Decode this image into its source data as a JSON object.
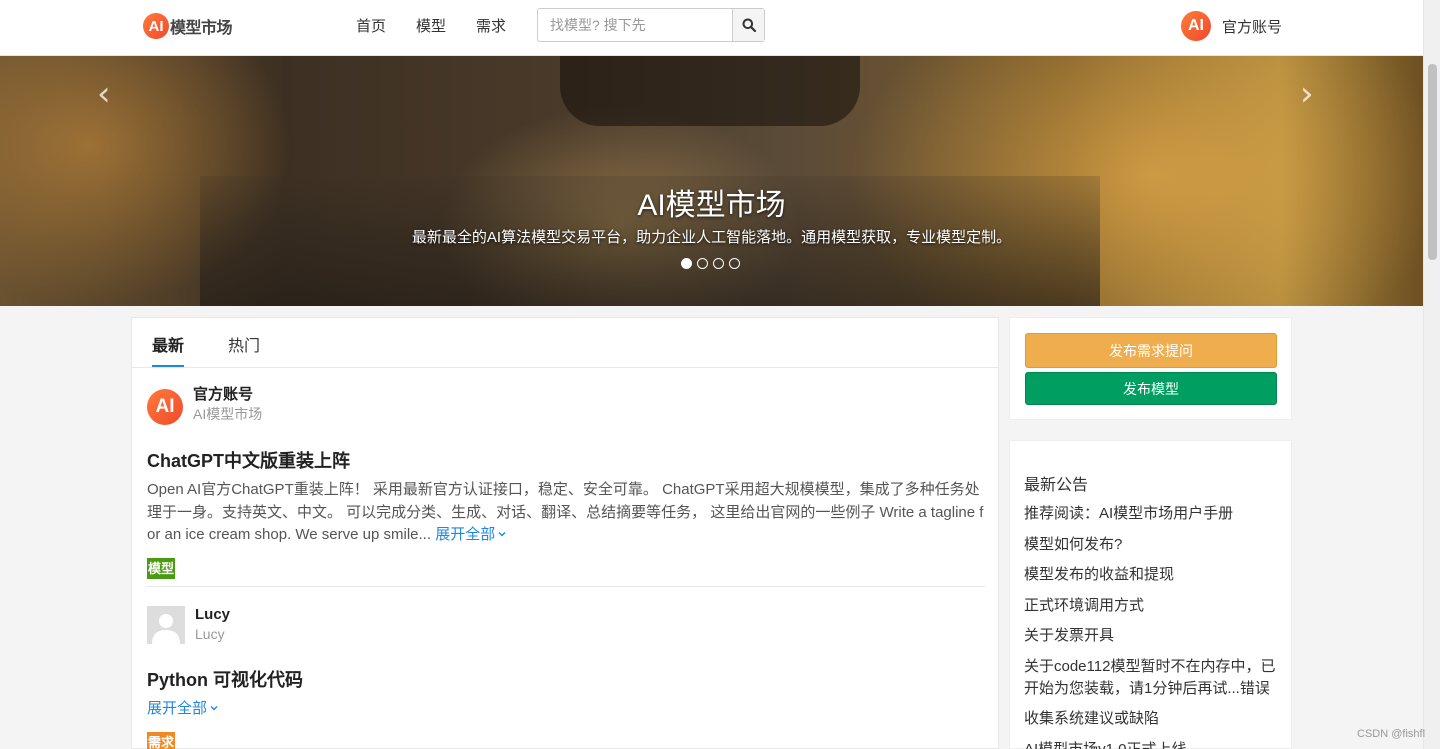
{
  "header": {
    "logo_badge": "AI",
    "logo_text": "模型市场",
    "nav": [
      "首页",
      "模型",
      "需求"
    ],
    "search_placeholder": "找模型? 搜下先",
    "search_icon": "search-icon",
    "account_badge": "AI",
    "account_name": "官方账号"
  },
  "banner": {
    "title": "AI模型市场",
    "subtitle": "最新最全的AI算法模型交易平台，助力企业人工智能落地。通用模型获取，专业模型定制。",
    "prev_icon": "chevron-left-icon",
    "next_icon": "chevron-right-icon",
    "active_slide": 1,
    "slide_count": 4
  },
  "tabs": [
    "最新",
    "热门"
  ],
  "posts": [
    {
      "avatar": "AI",
      "author": "官方账号",
      "author_sub": "AI模型市场",
      "title": "ChatGPT中文版重装上阵",
      "body": "Open AI官方ChatGPT重装上阵！ 采用最新官方认证接口，稳定、安全可靠。 ChatGPT采用超大规模模型，集成了多种任务处理于一身。支持英文、中文。 可以完成分类、生成、对话、翻译、总结摘要等任务， 这里给出官网的一些例子 Write a tagline for an ice cream shop. We serve up smile...",
      "expand": "展开全部",
      "tag": "模型",
      "tag_color": "#4a9a14"
    },
    {
      "author": "Lucy",
      "author_sub": "Lucy",
      "title": "Python 可视化代码",
      "expand": "展开全部",
      "tag": "需求",
      "tag_color": "#ef8a22"
    }
  ],
  "sidebar": {
    "publish_need": "发布需求提问",
    "publish_model": "发布模型",
    "notice_title": "最新公告",
    "notices": [
      "推荐阅读：AI模型市场用户手册",
      "模型如何发布?",
      "模型发布的收益和提现",
      "正式环境调用方式",
      "关于发票开具",
      "关于code112模型暂时不在内存中，已开始为您装载，请1分钟后再试...错误",
      "收集系统建议或缺陷",
      "AI模型市场v1.0正式上线"
    ]
  },
  "watermark": "CSDN @fishfl",
  "colors": {
    "accent_blue": "#1e88e5",
    "need_button": "#f0ad4e",
    "model_button": "#009e60",
    "logo_orange": "#f1492c"
  }
}
